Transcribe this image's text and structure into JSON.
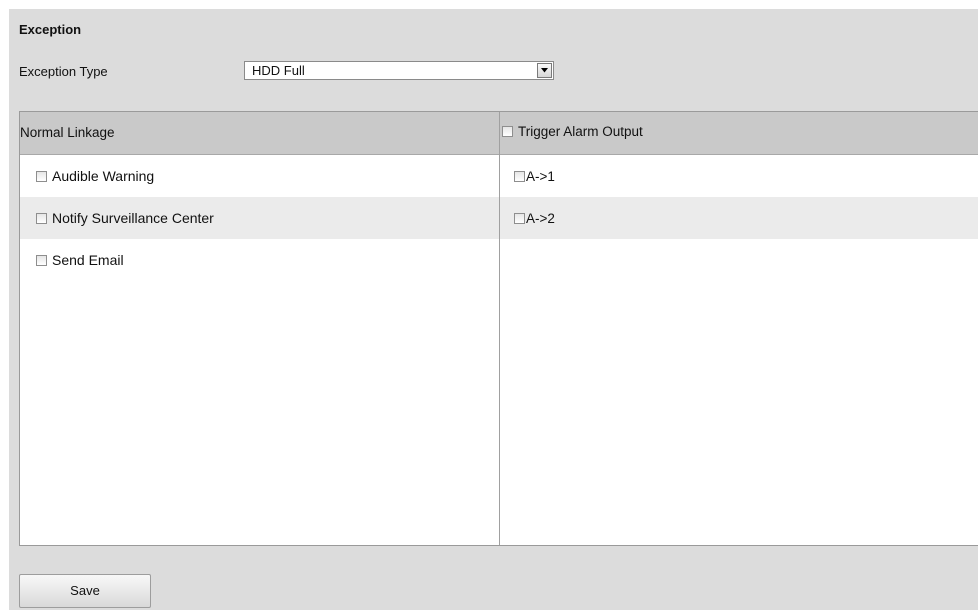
{
  "section": {
    "title": "Exception",
    "type_label": "Exception Type",
    "type_value": "HDD Full"
  },
  "normal_linkage": {
    "header": "Normal Linkage",
    "items": [
      {
        "label": "Audible Warning",
        "checked": false
      },
      {
        "label": "Notify Surveillance Center",
        "checked": false
      },
      {
        "label": "Send Email",
        "checked": false
      }
    ]
  },
  "trigger_alarm": {
    "header": "Trigger Alarm Output",
    "checked": false,
    "outputs": [
      {
        "label": "A->1",
        "checked": false
      },
      {
        "label": "A->2",
        "checked": false
      }
    ]
  },
  "actions": {
    "save_label": "Save"
  }
}
